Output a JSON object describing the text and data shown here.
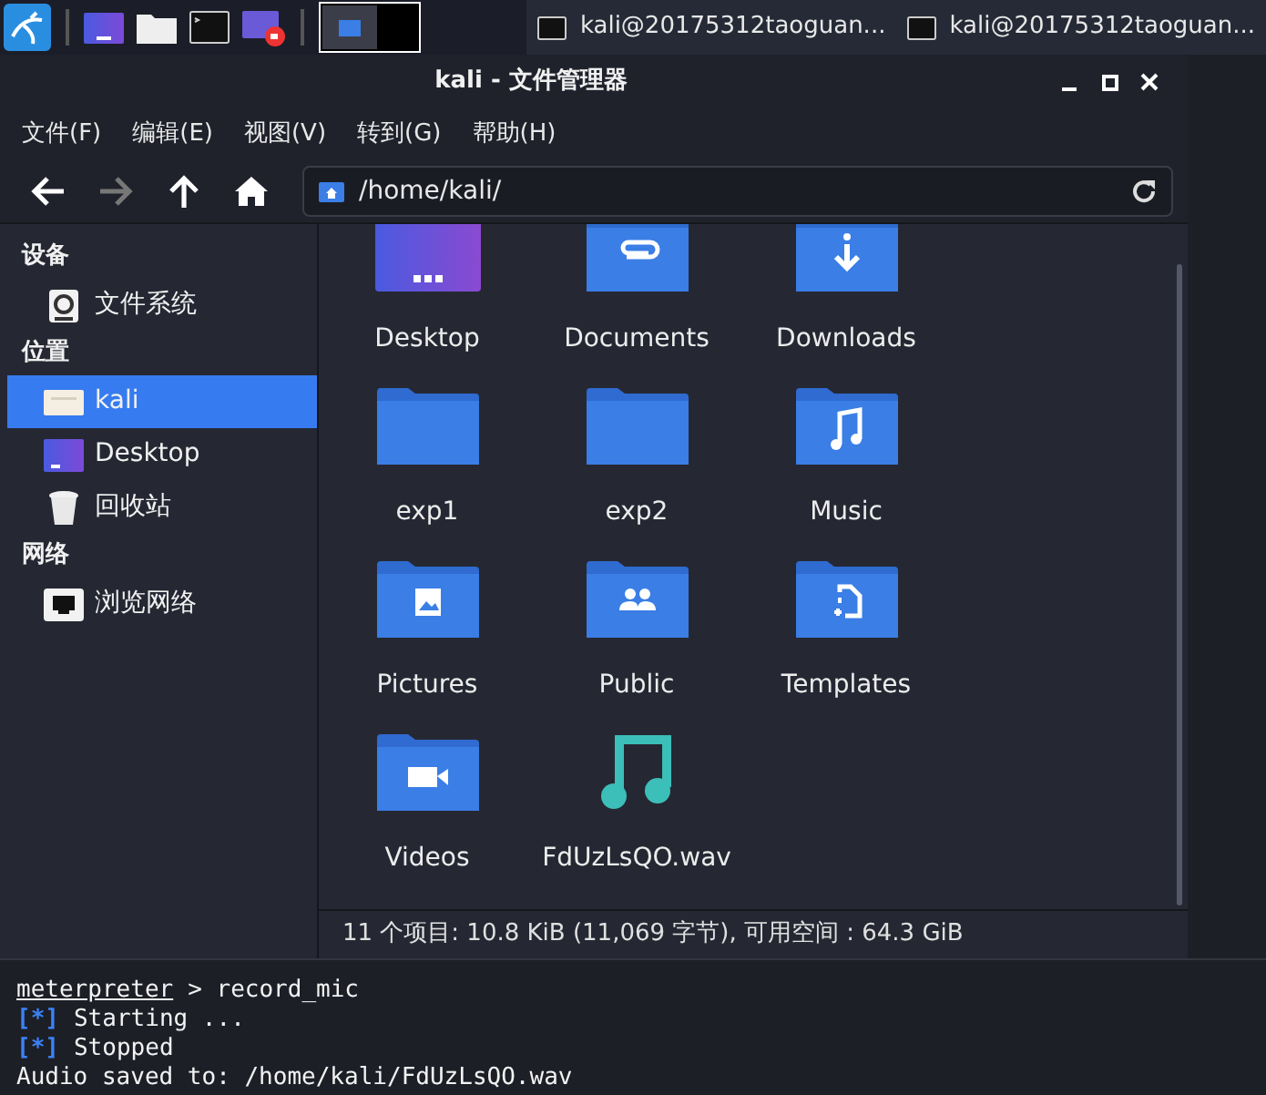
{
  "taskbar": {
    "tasks": [
      {
        "title": "kali@20175312taoguan..."
      },
      {
        "title": "kali@20175312taoguan..."
      }
    ]
  },
  "window": {
    "title": "kali - 文件管理器",
    "menu": [
      "文件(F)",
      "编辑(E)",
      "视图(V)",
      "转到(G)",
      "帮助(H)"
    ],
    "toolbar": {
      "forward_disabled": true
    },
    "address": "/home/kali/",
    "sidebar": [
      {
        "heading": "设备",
        "items": [
          {
            "label": "文件系统",
            "kind": "drive",
            "selected": false
          }
        ]
      },
      {
        "heading": "位置",
        "items": [
          {
            "label": "kali",
            "kind": "home",
            "selected": true
          },
          {
            "label": "Desktop",
            "kind": "desktop",
            "selected": false
          },
          {
            "label": "回收站",
            "kind": "trash",
            "selected": false
          }
        ]
      },
      {
        "heading": "网络",
        "items": [
          {
            "label": "浏览网络",
            "kind": "network",
            "selected": false
          }
        ]
      }
    ],
    "files": [
      {
        "name": "Desktop",
        "kind": "desktop"
      },
      {
        "name": "Documents",
        "kind": "documents"
      },
      {
        "name": "Downloads",
        "kind": "downloads"
      },
      {
        "name": "exp1",
        "kind": "folder"
      },
      {
        "name": "exp2",
        "kind": "folder"
      },
      {
        "name": "Music",
        "kind": "music"
      },
      {
        "name": "Pictures",
        "kind": "pictures"
      },
      {
        "name": "Public",
        "kind": "public"
      },
      {
        "name": "Templates",
        "kind": "templates"
      },
      {
        "name": "Videos",
        "kind": "videos"
      },
      {
        "name": "FdUzLsQO.wav",
        "kind": "audio"
      }
    ],
    "status": "11 个项目: 10.8 KiB (11,069 字节), 可用空间 : 64.3 GiB"
  },
  "terminal": [
    {
      "kind": "command",
      "prompt": "meterpreter",
      "text": "> record_mic"
    },
    {
      "kind": "info",
      "marker": "[*]",
      "text": "Starting ..."
    },
    {
      "kind": "info",
      "marker": "[*]",
      "text": "Stopped"
    },
    {
      "kind": "plain",
      "text": "Audio saved to: /home/kali/FdUzLsQO.wav"
    }
  ]
}
